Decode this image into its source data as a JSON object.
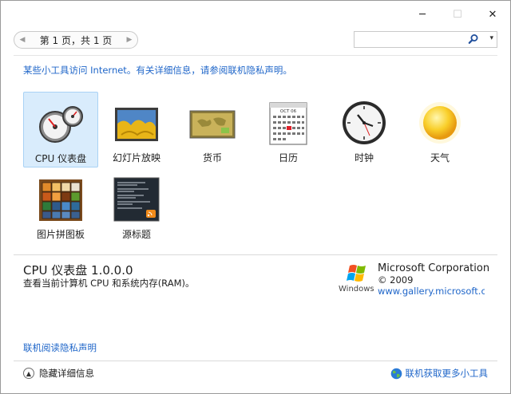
{
  "window": {
    "caption_buttons": {
      "minimize": "─",
      "maximize": "☐",
      "close": "✕"
    }
  },
  "toolbar": {
    "page_status": "第 1 页，共 1 页",
    "search_value": "",
    "search_icon": "magnifier",
    "dropdown_icon": "▾"
  },
  "notice": "某些小工具访问 Internet。有关详细信息，请参阅联机隐私声明。",
  "gadgets": [
    {
      "label": "CPU 仪表盘",
      "icon": "cpu-meter-icon",
      "selected": true
    },
    {
      "label": "幻灯片放映",
      "icon": "slideshow-icon",
      "selected": false
    },
    {
      "label": "货币",
      "icon": "currency-icon",
      "selected": false
    },
    {
      "label": "日历",
      "icon": "calendar-icon",
      "selected": false
    },
    {
      "label": "时钟",
      "icon": "clock-icon",
      "selected": false
    },
    {
      "label": "天气",
      "icon": "weather-icon",
      "selected": false
    },
    {
      "label": "图片拼图板",
      "icon": "puzzle-icon",
      "selected": false
    },
    {
      "label": "源标题",
      "icon": "feed-headlines-icon",
      "selected": false
    }
  ],
  "calendar_icon_text": "OCT 06",
  "details": {
    "title": "CPU 仪表盘 1.0.0.0",
    "description": "查看当前计算机 CPU 和系统内存(RAM)。",
    "publisher": "Microsoft Corporation",
    "year": "© 2009",
    "link": "www.gallery.microsoft.com",
    "logo_text": "Windows"
  },
  "privacy_link": "联机阅读隐私声明",
  "footer": {
    "toggle_label": "隐藏详细信息",
    "online_label": "联机获取更多小工具"
  },
  "colors": {
    "link": "#1f66c9",
    "selected_bg": "#d9ecfc",
    "selected_border": "#a9d2f5"
  }
}
